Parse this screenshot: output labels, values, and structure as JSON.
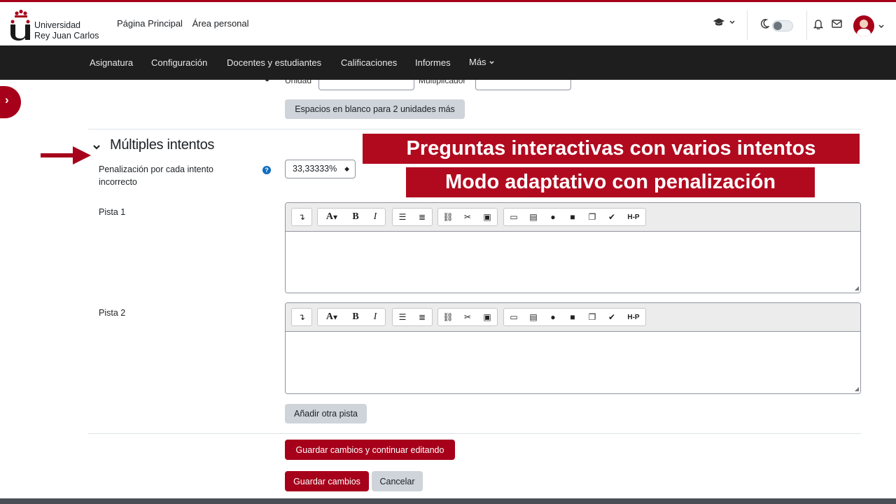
{
  "header": {
    "brand_line1": "Universidad",
    "brand_line2": "Rey Juan Carlos",
    "nav": [
      "Página Principal",
      "Área personal"
    ]
  },
  "secondary_nav": [
    "Asignatura",
    "Configuración",
    "Docentes y estudiantes",
    "Calificaciones",
    "Informes",
    "Más"
  ],
  "partial_fields": {
    "unit_label": "Unidad",
    "multiplier_label": "Multiplicador",
    "add_units_button": "Espacios en blanco para 2 unidades más"
  },
  "section": {
    "title": "Múltiples intentos",
    "penalty_label": "Penalización por cada intento incorrecto",
    "penalty_value": "33,33333%",
    "hint1_label": "Pista 1",
    "hint2_label": "Pista 2",
    "add_hint_button": "Añadir otra pista"
  },
  "overlay": {
    "line1": "Preguntas interactivas con varios intentos",
    "line2": "Modo adaptativo con penalización"
  },
  "actions": {
    "save_continue": "Guardar cambios y continuar editando",
    "save": "Guardar cambios",
    "cancel": "Cancelar"
  },
  "editor_toolbar": {
    "buttons": [
      "collapse",
      "font-color",
      "bold",
      "italic",
      "bullet-list",
      "numbered-list",
      "link",
      "unlink",
      "teams",
      "image",
      "media-file",
      "record-audio",
      "record-video",
      "manage-files",
      "accessibility",
      "h5p"
    ],
    "h5p_label": "H-P"
  },
  "colors": {
    "brand_red": "#a6001a",
    "nav_bg": "#1e1e1e",
    "grey_button": "#ced4da"
  }
}
